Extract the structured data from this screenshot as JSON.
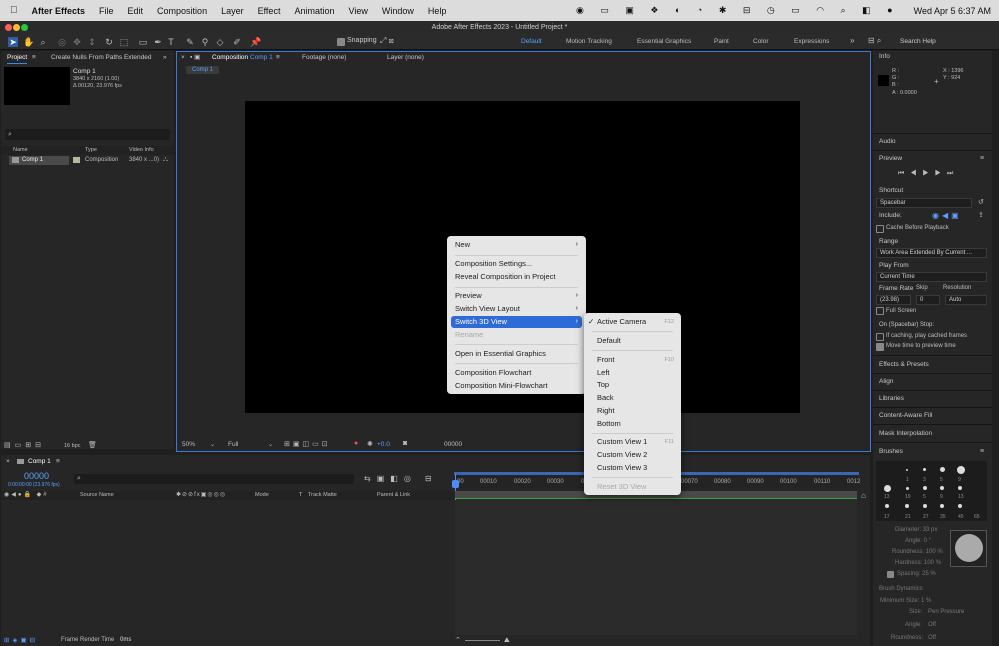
{
  "menubar": {
    "app": "After Effects",
    "items": [
      "File",
      "Edit",
      "Composition",
      "Layer",
      "Effect",
      "Animation",
      "View",
      "Window",
      "Help"
    ],
    "datetime": "Wed Apr 5  6:37 AM"
  },
  "window_title": "Adobe After Effects 2023 - Untitled Project *",
  "toolbar": {
    "snapping": "Snapping",
    "workspaces": [
      "Default",
      "Motion Tracking",
      "Essential Graphics",
      "Paint",
      "Color",
      "Expressions"
    ],
    "search_placeholder": "Search Help"
  },
  "project": {
    "tab": "Project",
    "tab2": "Create Nulls From Paths Extended",
    "item_name": "Comp 1",
    "item_meta1": "3840 x 2160 (1.00)",
    "item_meta2": "Δ 00120, 23.976 fps",
    "cols": {
      "name": "Name",
      "type": "Type",
      "video": "Video Info"
    },
    "row": {
      "name": "Comp 1",
      "type": "Composition",
      "video": "3840 x ...0)"
    },
    "bpc": "16 bpc"
  },
  "comp": {
    "tab_prefix": "Composition",
    "tab_name": "Comp 1",
    "footage": "Footage (none)",
    "layer": "Layer (none)",
    "crumb": "Comp 1",
    "zoom": "50%",
    "res": "Full",
    "exposure": "+0.0",
    "timecode": "00000"
  },
  "context_menu": {
    "items": [
      {
        "label": "New",
        "sub": true
      },
      {
        "label": "Composition Settings..."
      },
      {
        "label": "Reveal Composition in Project"
      },
      {
        "label": "Preview",
        "sub": true
      },
      {
        "label": "Switch View Layout",
        "sub": true
      },
      {
        "label": "Switch 3D View",
        "sub": true,
        "active": true
      },
      {
        "label": "Rename",
        "disabled": true
      },
      {
        "label": "Open in Essential Graphics"
      },
      {
        "label": "Composition Flowchart"
      },
      {
        "label": "Composition Mini-Flowchart"
      }
    ]
  },
  "submenu": {
    "items": [
      {
        "label": "Active Camera",
        "check": "✓",
        "shortcut": "F12"
      },
      {
        "label": "Default"
      },
      {
        "label": "Front",
        "shortcut": "F10"
      },
      {
        "label": "Left"
      },
      {
        "label": "Top"
      },
      {
        "label": "Back"
      },
      {
        "label": "Right"
      },
      {
        "label": "Bottom"
      },
      {
        "label": "Custom View 1",
        "shortcut": "F11"
      },
      {
        "label": "Custom View 2"
      },
      {
        "label": "Custom View 3"
      },
      {
        "label": "Reset 3D View",
        "disabled": true
      }
    ]
  },
  "info": {
    "title": "Info",
    "r": "R :",
    "g": "G :",
    "b": "B :",
    "a": "A :  0.0000",
    "x": "X : 1396",
    "y": "Y : 924"
  },
  "right": {
    "audio": "Audio",
    "preview": "Preview",
    "shortcut": "Shortcut",
    "spacebar": "Spacebar",
    "include": "Include:",
    "cache": "Cache Before Playback",
    "range": "Range",
    "range_val": "Work Area Extended By Current ...",
    "play_from": "Play From",
    "play_from_val": "Current Time",
    "frame_rate": "Frame Rate",
    "skip": "Skip",
    "resolution": "Resolution",
    "fr_val": "(23.98)",
    "skip_val": "0",
    "res_val": "Auto",
    "full_screen": "Full Screen",
    "on_stop": "On (Spacebar) Stop:",
    "if_caching": "If caching, play cached frames",
    "move_time": "Move time to preview time",
    "effects": "Effects & Presets",
    "align": "Align",
    "libraries": "Libraries",
    "caf": "Content-Aware Fill",
    "mask": "Mask Interpolation",
    "brushes": "Brushes",
    "brush_nums": [
      "1",
      "3",
      "5",
      "9",
      "13",
      "19",
      "5",
      "9",
      "13",
      "17",
      "21",
      "27",
      "35",
      "45",
      "65"
    ],
    "diameter": "Diameter: 33 px",
    "angle": "Angle: 0 °",
    "roundness": "Roundness: 100 %",
    "hardness": "Hardness: 100 %",
    "spacing": "Spacing: 25 %",
    "dynamics": "Brush Dynamics",
    "min_size": "Minimum Size: 1 %",
    "pen_pressure": "Pen Pressure",
    "size": "Size:",
    "angle2": "Angle:",
    "roundness2": "Roundness:",
    "off1": "Off",
    "off2": "Off"
  },
  "timeline": {
    "tab": "Comp 1",
    "time": "00000",
    "fps": "0:00:00:00 (23.976 fps)",
    "cols": {
      "source": "Source Name",
      "mode": "Mode",
      "t": "T",
      "track": "Track Matte",
      "parent": "Parent & Link"
    },
    "ticks": [
      "00",
      "00010",
      "00020",
      "00030",
      "0",
      "00070",
      "00080",
      "00090",
      "00100",
      "00110",
      "0012"
    ],
    "render": "Frame Render Time",
    "render_val": "0ms"
  }
}
